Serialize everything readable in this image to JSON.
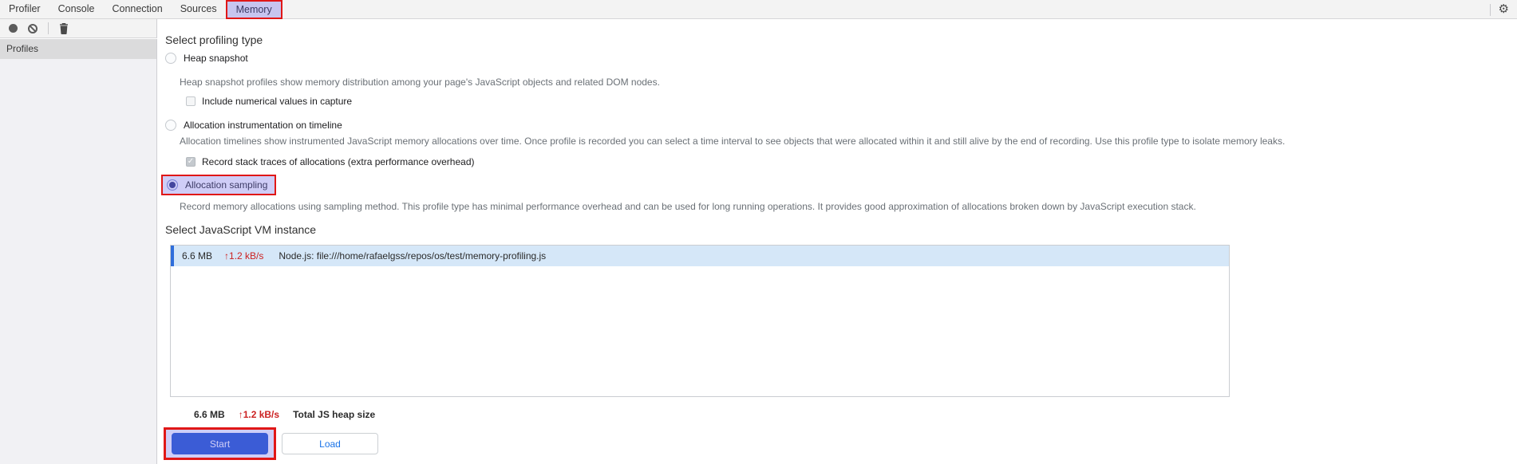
{
  "colors": {
    "accent_red": "#e01717",
    "highlight_lavender": "rgba(118,111,232,0.35)",
    "row_highlight_blue": "#d5e7f8",
    "row_accent_blue": "#2f6edb",
    "start_button_blue": "#1c52cc",
    "rate_red": "#cc2222"
  },
  "icons": {
    "gear": "⚙",
    "check": "✓",
    "record": "filled-circle",
    "block": "circle-slash",
    "trash": "trash-can"
  },
  "tabs": {
    "items": [
      {
        "label": "Profiler",
        "selected": false
      },
      {
        "label": "Console",
        "selected": false
      },
      {
        "label": "Connection",
        "selected": false
      },
      {
        "label": "Sources",
        "selected": false
      },
      {
        "label": "Memory",
        "selected": true
      }
    ]
  },
  "sidebar": {
    "profiles_label": "Profiles"
  },
  "main": {
    "profiling_type_heading": "Select profiling type",
    "options": [
      {
        "label": "Heap snapshot",
        "selected": false,
        "description": "Heap snapshot profiles show memory distribution among your page's JavaScript objects and related DOM nodes.",
        "checkbox": {
          "label": "Include numerical values in capture",
          "checked": false
        }
      },
      {
        "label": "Allocation instrumentation on timeline",
        "selected": false,
        "description": "Allocation timelines show instrumented JavaScript memory allocations over time. Once profile is recorded you can select a time interval to see objects that were allocated within it and still alive by the end of recording. Use this profile type to isolate memory leaks.",
        "checkbox": {
          "label": "Record stack traces of allocations (extra performance overhead)",
          "checked": true
        }
      },
      {
        "label": "Allocation sampling",
        "selected": true,
        "highlighted": true,
        "description": "Record memory allocations using sampling method. This profile type has minimal performance overhead and can be used for long running operations. It provides good approximation of allocations broken down by JavaScript execution stack."
      }
    ],
    "vm_heading": "Select JavaScript VM instance",
    "vm_row": {
      "size": "6.6 MB",
      "rate": "↑1.2 kB/s",
      "name": "Node.js: file:///home/rafaelgss/repos/os/test/memory-profiling.js"
    },
    "totals": {
      "size": "6.6 MB",
      "rate": "↑1.2 kB/s",
      "label": "Total JS heap size"
    },
    "buttons": {
      "start": "Start",
      "load": "Load"
    }
  }
}
